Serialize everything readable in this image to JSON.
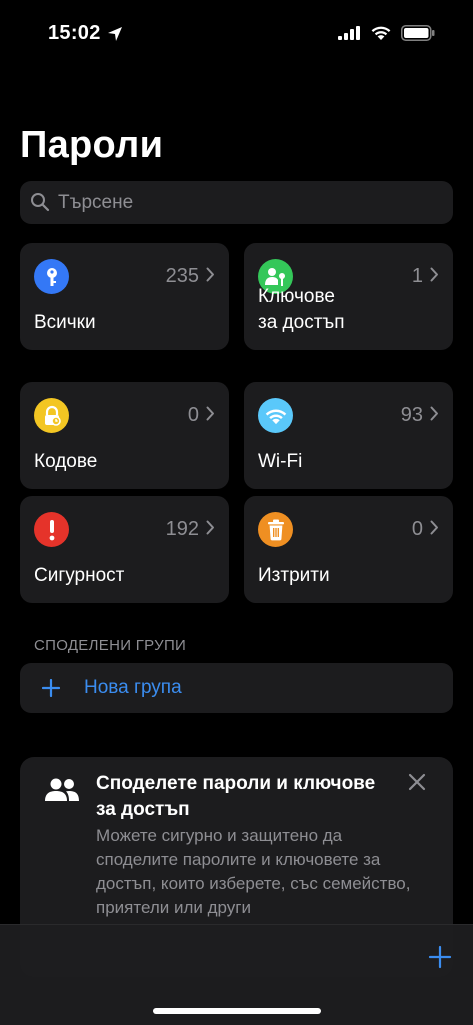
{
  "status_bar": {
    "time": "15:02"
  },
  "title": "Пароли",
  "search": {
    "placeholder": "Търсене"
  },
  "tiles": [
    {
      "label": "Всички",
      "count": "235",
      "icon": "key-icon",
      "color": "#3478f6"
    },
    {
      "label": "Ключове\nза достъп",
      "count": "1",
      "icon": "passkey-icon",
      "color": "#34c759"
    },
    {
      "label": "Кодове",
      "count": "0",
      "icon": "lock-clock-icon",
      "color": "#f3c623"
    },
    {
      "label": "Wi-Fi",
      "count": "93",
      "icon": "wifi-icon",
      "color": "#5ac8fa"
    },
    {
      "label": "Сигурност",
      "count": "192",
      "icon": "exclamation-icon",
      "color": "#e5332a"
    },
    {
      "label": "Изтрити",
      "count": "0",
      "icon": "trash-icon",
      "color": "#ef8f22"
    }
  ],
  "shared_groups": {
    "header": "СПОДЕЛЕНИ ГРУПИ",
    "new_group_label": "Нова група"
  },
  "share_card": {
    "title": "Споделете пароли и ключове за достъп",
    "body": "Можете сигурно и защитено да споделите паролите и ключовете за достъп, които изберете, със семейство, приятели или други"
  },
  "colors": {
    "accent": "#3b8df0",
    "tile_bg": "#1c1c1e",
    "secondary_text": "#8e8e93"
  }
}
